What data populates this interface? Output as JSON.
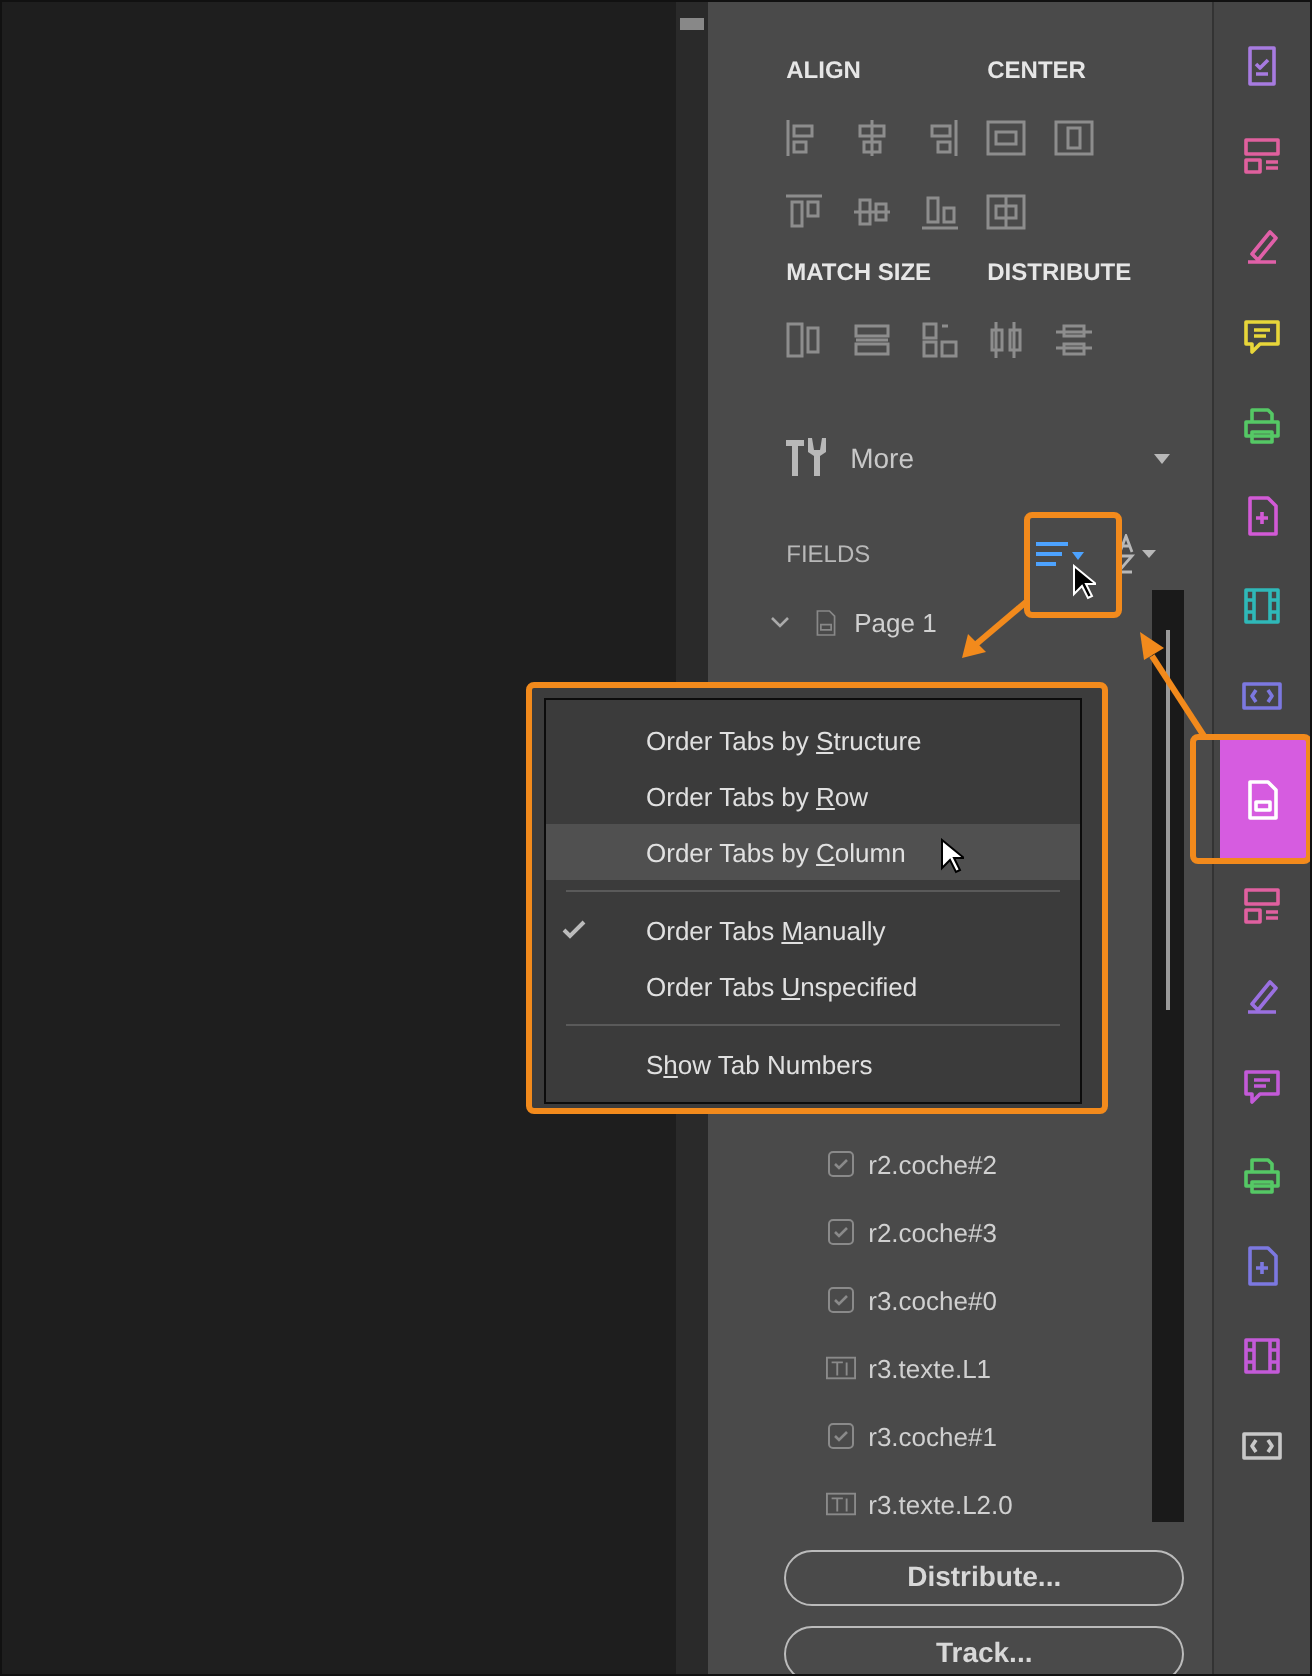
{
  "panel": {
    "sections": [
      {
        "title": "ALIGN"
      },
      {
        "title": "CENTER"
      },
      {
        "title": "MATCH SIZE"
      },
      {
        "title": "DISTRIBUTE"
      }
    ],
    "more": {
      "label": "More"
    },
    "fields": {
      "title": "FIELDS",
      "page": {
        "label": "Page 1",
        "expanded": true
      },
      "items": [
        {
          "kind": "checkbox",
          "label": "r2.coche#2"
        },
        {
          "kind": "checkbox",
          "label": "r2.coche#3"
        },
        {
          "kind": "checkbox",
          "label": "r3.coche#0"
        },
        {
          "kind": "text",
          "label": "r3.texte.L1"
        },
        {
          "kind": "checkbox",
          "label": "r3.coche#1"
        },
        {
          "kind": "text",
          "label": "r3.texte.L2.0"
        }
      ]
    },
    "buttons": [
      {
        "label": "Distribute..."
      },
      {
        "label": "Track..."
      }
    ]
  },
  "menu": {
    "items": [
      {
        "kind": "item",
        "before": "Order Tabs by ",
        "key": "S",
        "after": "tructure",
        "checked": false,
        "selected": false
      },
      {
        "kind": "item",
        "before": "Order Tabs by ",
        "key": "R",
        "after": "ow",
        "checked": false,
        "selected": false
      },
      {
        "kind": "item",
        "before": "Order Tabs by ",
        "key": "C",
        "after": "olumn",
        "checked": false,
        "selected": true
      },
      {
        "kind": "separator"
      },
      {
        "kind": "item",
        "before": "Order Tabs ",
        "key": "M",
        "after": "anually",
        "checked": true,
        "selected": false
      },
      {
        "kind": "item",
        "before": "Order Tabs ",
        "key": "U",
        "after": "nspecified",
        "checked": false,
        "selected": false
      },
      {
        "kind": "separator"
      },
      {
        "kind": "item",
        "before": "S",
        "key": "h",
        "after": "ow Tab Numbers",
        "checked": false,
        "selected": false
      }
    ]
  },
  "toolbar": {
    "tools": [
      {
        "selected": false
      },
      {
        "selected": false
      },
      {
        "selected": false
      },
      {
        "selected": false
      },
      {
        "selected": false
      },
      {
        "selected": false
      },
      {
        "selected": false
      },
      {
        "selected": false
      },
      {
        "selected": true
      },
      {
        "selected": false
      },
      {
        "selected": false
      },
      {
        "selected": false
      },
      {
        "selected": false
      },
      {
        "selected": false
      },
      {
        "selected": false
      },
      {
        "selected": false
      }
    ]
  }
}
